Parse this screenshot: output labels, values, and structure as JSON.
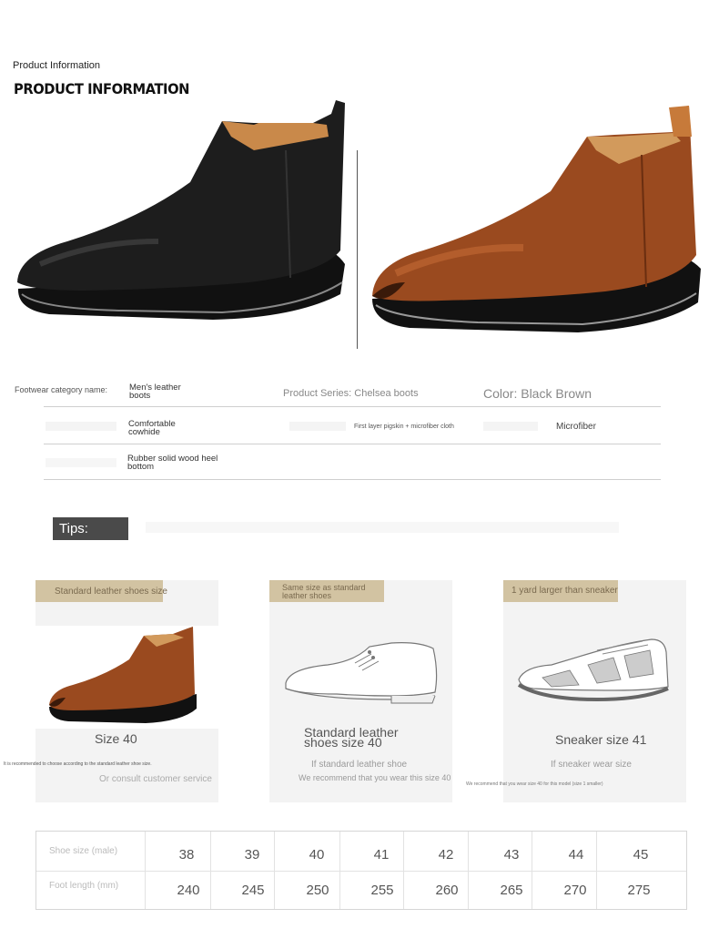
{
  "header": {
    "small_title": "Product Information",
    "big_title": "PRODUCT INFORMATION"
  },
  "colors": {
    "black_boot": "#1c1c1c",
    "brown_boot": "#9a4a1f",
    "tag_bg": "#d2c3a2",
    "tips_bg": "#4a4a4a"
  },
  "info": {
    "category_label": "Footwear category name:",
    "category_value": "Men's leather boots",
    "series": "Product Series: Chelsea boots",
    "color": "Color: Black Brown",
    "material_value": "Comfortable cowhide",
    "lining": "First layer pigskin + microfiber cloth",
    "insole": "Microfiber",
    "sole_value": "Rubber solid wood heel bottom"
  },
  "tips": {
    "label": "Tips:"
  },
  "cards": [
    {
      "tag": "Standard leather shoes size",
      "title": "Size 40",
      "note_tiny": "It is recommended to choose according to the standard leather shoe size.",
      "note": "Or consult customer service"
    },
    {
      "tag": "Same size as standard leather shoes",
      "title": "Standard leather shoes size 40",
      "note": "If standard leather shoe",
      "note2": "We recommend that you wear this size 40"
    },
    {
      "tag": "1 yard larger than sneaker",
      "title": "Sneaker size 41",
      "note": "If sneaker wear size",
      "note_tiny": "We recommend that you wear size 40 for this model (size 1 smaller)"
    }
  ],
  "size_table": {
    "row1_label": "Shoe size (male)",
    "row2_label": "Foot length (mm)",
    "sizes": [
      "38",
      "39",
      "40",
      "41",
      "42",
      "43",
      "44",
      "45"
    ],
    "lengths": [
      "240",
      "245",
      "250",
      "255",
      "260",
      "265",
      "270",
      "275"
    ]
  }
}
